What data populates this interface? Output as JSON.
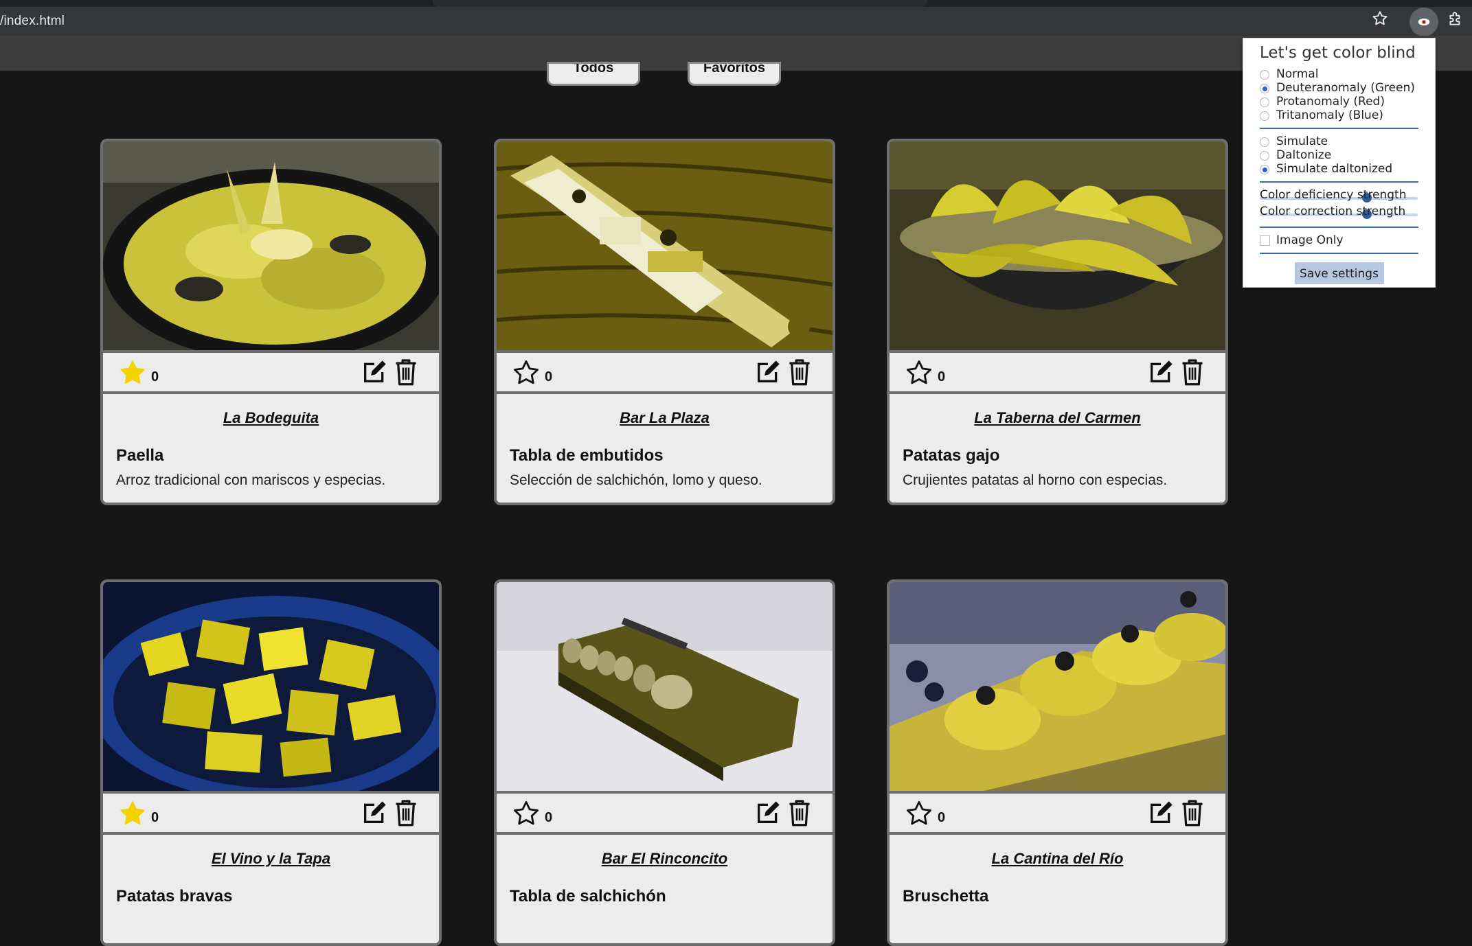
{
  "browser": {
    "address": "/index.html",
    "bookmark_icon": "star-outline-icon",
    "extension_icon": "eye-icon",
    "extensions_icon": "puzzle-icon"
  },
  "filters": {
    "all_label": "Todos",
    "favorites_label": "Favoritos"
  },
  "cards": [
    {
      "restaurant": "La Bodeguita",
      "dish": "Paella",
      "description": "Arroz tradicional con mariscos y especias.",
      "favorite": true,
      "count": "0"
    },
    {
      "restaurant": "Bar La Plaza",
      "dish": "Tabla de embutidos",
      "description": "Selección de salchichón, lomo y queso.",
      "favorite": false,
      "count": "0"
    },
    {
      "restaurant": "La Taberna del Carmen",
      "dish": "Patatas gajo",
      "description": "Crujientes patatas al horno con especias.",
      "favorite": false,
      "count": "0"
    },
    {
      "restaurant": "El Vino y la Tapa",
      "dish": "Patatas bravas",
      "description": "",
      "favorite": true,
      "count": "0"
    },
    {
      "restaurant": "Bar El Rinconcito",
      "dish": "Tabla de salchichón",
      "description": "",
      "favorite": false,
      "count": "0"
    },
    {
      "restaurant": "La Cantina del Río",
      "dish": "Bruschetta",
      "description": "",
      "favorite": false,
      "count": "0"
    }
  ],
  "popup": {
    "title": "Let's get color blind",
    "types": [
      {
        "label": "Normal",
        "checked": false
      },
      {
        "label": "Deuteranomaly (Green)",
        "checked": true
      },
      {
        "label": "Protanomaly (Red)",
        "checked": false
      },
      {
        "label": "Tritanomaly (Blue)",
        "checked": false
      }
    ],
    "modes": [
      {
        "label": "Simulate",
        "checked": false
      },
      {
        "label": "Daltonize",
        "checked": false
      },
      {
        "label": "Simulate daltonized",
        "checked": true
      }
    ],
    "deficiency_label": "Color deficiency strength",
    "deficiency_value": 0.68,
    "correction_label": "Color correction strength",
    "correction_value": 0.68,
    "image_only_label": "Image Only",
    "image_only": false,
    "save_label": "Save settings"
  },
  "colors": {
    "page_bg": "#161616",
    "card_bg": "#ececec",
    "favorite_star": "#f2d300",
    "accent": "#2c64c4"
  }
}
